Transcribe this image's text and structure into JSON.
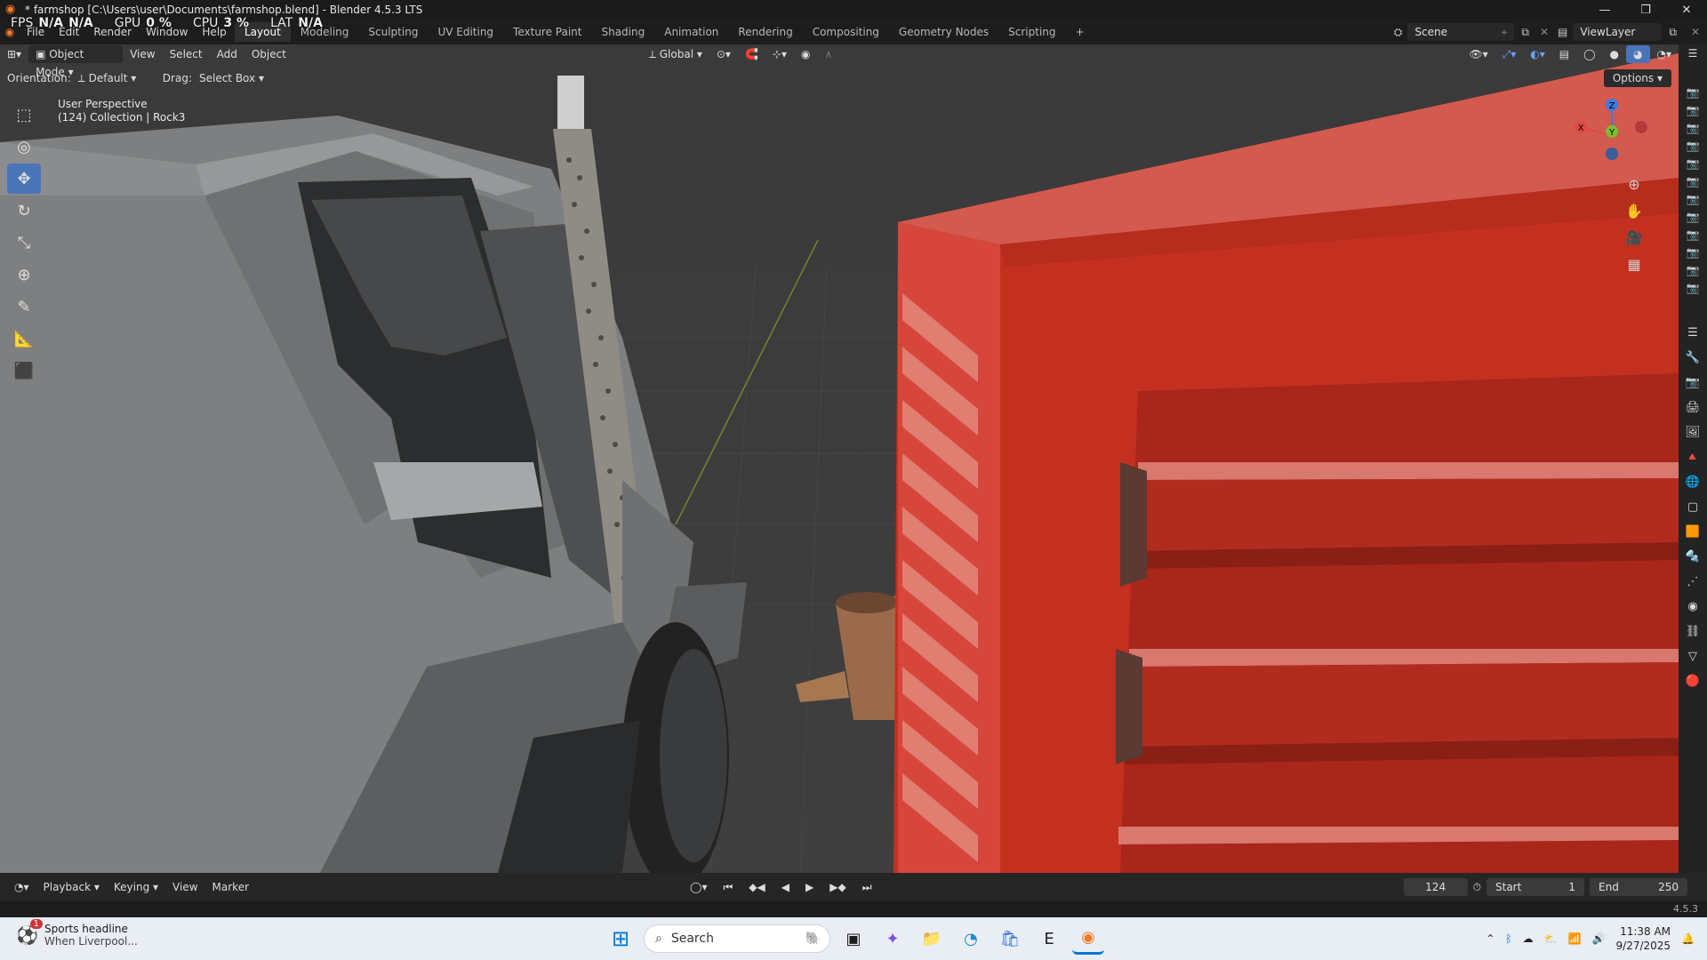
{
  "window": {
    "title": "* farmshop [C:\\Users\\user\\Documents\\farmshop.blend] - Blender 4.5.3 LTS",
    "controls": [
      "—",
      "❐",
      "✕"
    ]
  },
  "perf": {
    "fps_label": "FPS",
    "fps_value": "N/A",
    "fps_value2": "N/A",
    "gpu_label": "GPU",
    "gpu_value": "0 %",
    "cpu_label": "CPU",
    "cpu_value": "3 %",
    "lat_label": "LAT",
    "lat_value": "N/A"
  },
  "menu": {
    "items": [
      "File",
      "Edit",
      "Render",
      "Window",
      "Help"
    ]
  },
  "workspaces": [
    "Layout",
    "Modeling",
    "Sculpting",
    "UV Editing",
    "Texture Paint",
    "Shading",
    "Animation",
    "Rendering",
    "Compositing",
    "Geometry Nodes",
    "Scripting",
    "+"
  ],
  "scene": {
    "scene_name": "Scene",
    "view_layer": "ViewLayer"
  },
  "viewport_header": {
    "mode": "Object Mode",
    "menus": [
      "View",
      "Select",
      "Add",
      "Object"
    ],
    "transform_orientation": "Global"
  },
  "tool_settings": {
    "orientation_label": "Orientation:",
    "orientation_value": "Default",
    "drag_label": "Drag:",
    "drag_value": "Select Box",
    "options": "Options"
  },
  "viewport": {
    "perspective": "User Perspective",
    "collection_info": "(124) Collection | Rock3"
  },
  "gizmo": {
    "x": "X",
    "y": "Y",
    "z": "Z"
  },
  "timeline": {
    "menus": [
      "Playback",
      "Keying",
      "View",
      "Marker"
    ],
    "current_frame": "124",
    "start_label": "Start",
    "start_value": "1",
    "end_label": "End",
    "end_value": "250",
    "version": "4.5.3"
  },
  "taskbar": {
    "news_badge": "1",
    "news_title": "Sports headline",
    "news_sub": "When Liverpool...",
    "search_placeholder": "Search",
    "time": "11:38 AM",
    "date": "9/27/2025"
  },
  "colors": {
    "accent": "#4a74b8",
    "red_object": "#c7301e",
    "viewport_bg": "#3b3b3b"
  }
}
